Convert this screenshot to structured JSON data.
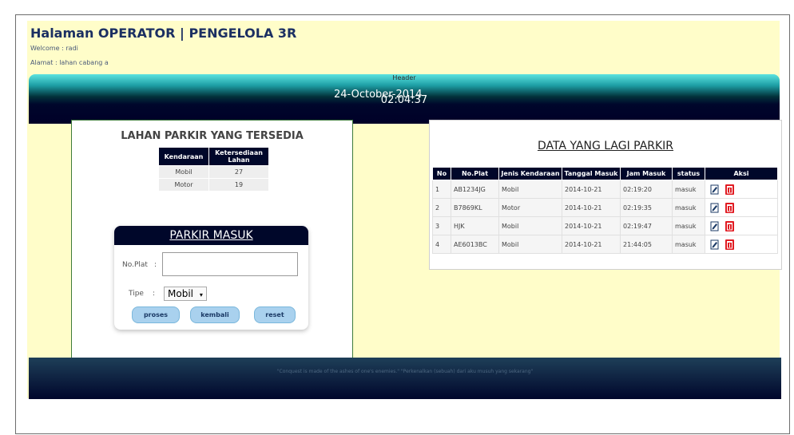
{
  "page": {
    "title": "Halaman OPERATOR | PENGELOLA 3R",
    "welcome": "Welcome : radi",
    "alamat": "Alamat : lahan cabang a"
  },
  "header": {
    "label": "Header",
    "time": "02:04:37",
    "date": "24-October-2014"
  },
  "availability": {
    "title": "LAHAN PARKIR YANG TERSEDIA",
    "columns": [
      "Kendaraan",
      "Ketersediaan Lahan"
    ],
    "rows": [
      [
        "Mobil",
        "27"
      ],
      [
        "Motor",
        "19"
      ]
    ]
  },
  "parkir_masuk": {
    "title": "PARKIR MASUK",
    "plat_label": "No.Plat",
    "plat_value": "",
    "tipe_label": "Tipe",
    "tipe_value": "Mobil",
    "separator": ":",
    "buttons": {
      "proses": "proses",
      "kembali": "kembali",
      "reset": "reset"
    }
  },
  "parked": {
    "title": "DATA YANG LAGI PARKIR",
    "columns": [
      "No",
      "No.Plat",
      "Jenis Kendaraan",
      "Tanggal Masuk",
      "Jam Masuk",
      "status",
      "Aksi"
    ],
    "rows": [
      [
        "1",
        "AB1234JG",
        "Mobil",
        "2014-10-21",
        "02:19:20",
        "masuk"
      ],
      [
        "2",
        "B7869KL",
        "Motor",
        "2014-10-21",
        "02:19:35",
        "masuk"
      ],
      [
        "3",
        "HJK",
        "Mobil",
        "2014-10-21",
        "02:19:47",
        "masuk"
      ],
      [
        "4",
        "AE6013BC",
        "Mobil",
        "2014-10-21",
        "21:44:05",
        "masuk"
      ]
    ],
    "action_icons": [
      "edit-icon",
      "delete-icon"
    ],
    "colors": {
      "header_bg": "#00072a",
      "delete": "#e11b22",
      "edit": "#1b3a66"
    }
  },
  "footer": {
    "text": "\"Conquest is made of the ashes of one's enemies.\" \"Perkenalkan (sebuah) dari aku musuh yang sekarang\""
  },
  "colors": {
    "page_bg": "#fffdc9",
    "title": "#1b2f62",
    "header_top": "#5ce3df",
    "header_bottom": "#000028",
    "button": "#a9d1ee"
  }
}
